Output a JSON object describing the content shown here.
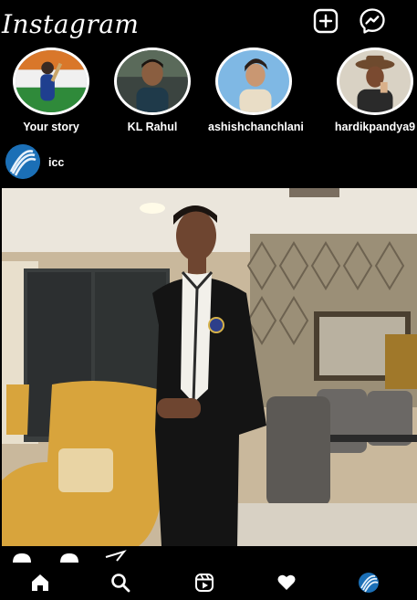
{
  "app": {
    "brand": "Instagram"
  },
  "header": {
    "new_post_icon": "plus-square-icon",
    "messenger_icon": "messenger-icon"
  },
  "stories": [
    {
      "label": "Your story"
    },
    {
      "label": "KL Rahul"
    },
    {
      "label": "ashishchanchlani"
    },
    {
      "label": "hardikpandya9"
    }
  ],
  "post": {
    "username": "icc"
  },
  "bottom_nav": [
    {
      "icon": "home-icon"
    },
    {
      "icon": "search-icon"
    },
    {
      "icon": "reels-icon"
    },
    {
      "icon": "heart-icon"
    },
    {
      "icon": "profile-icon"
    }
  ]
}
